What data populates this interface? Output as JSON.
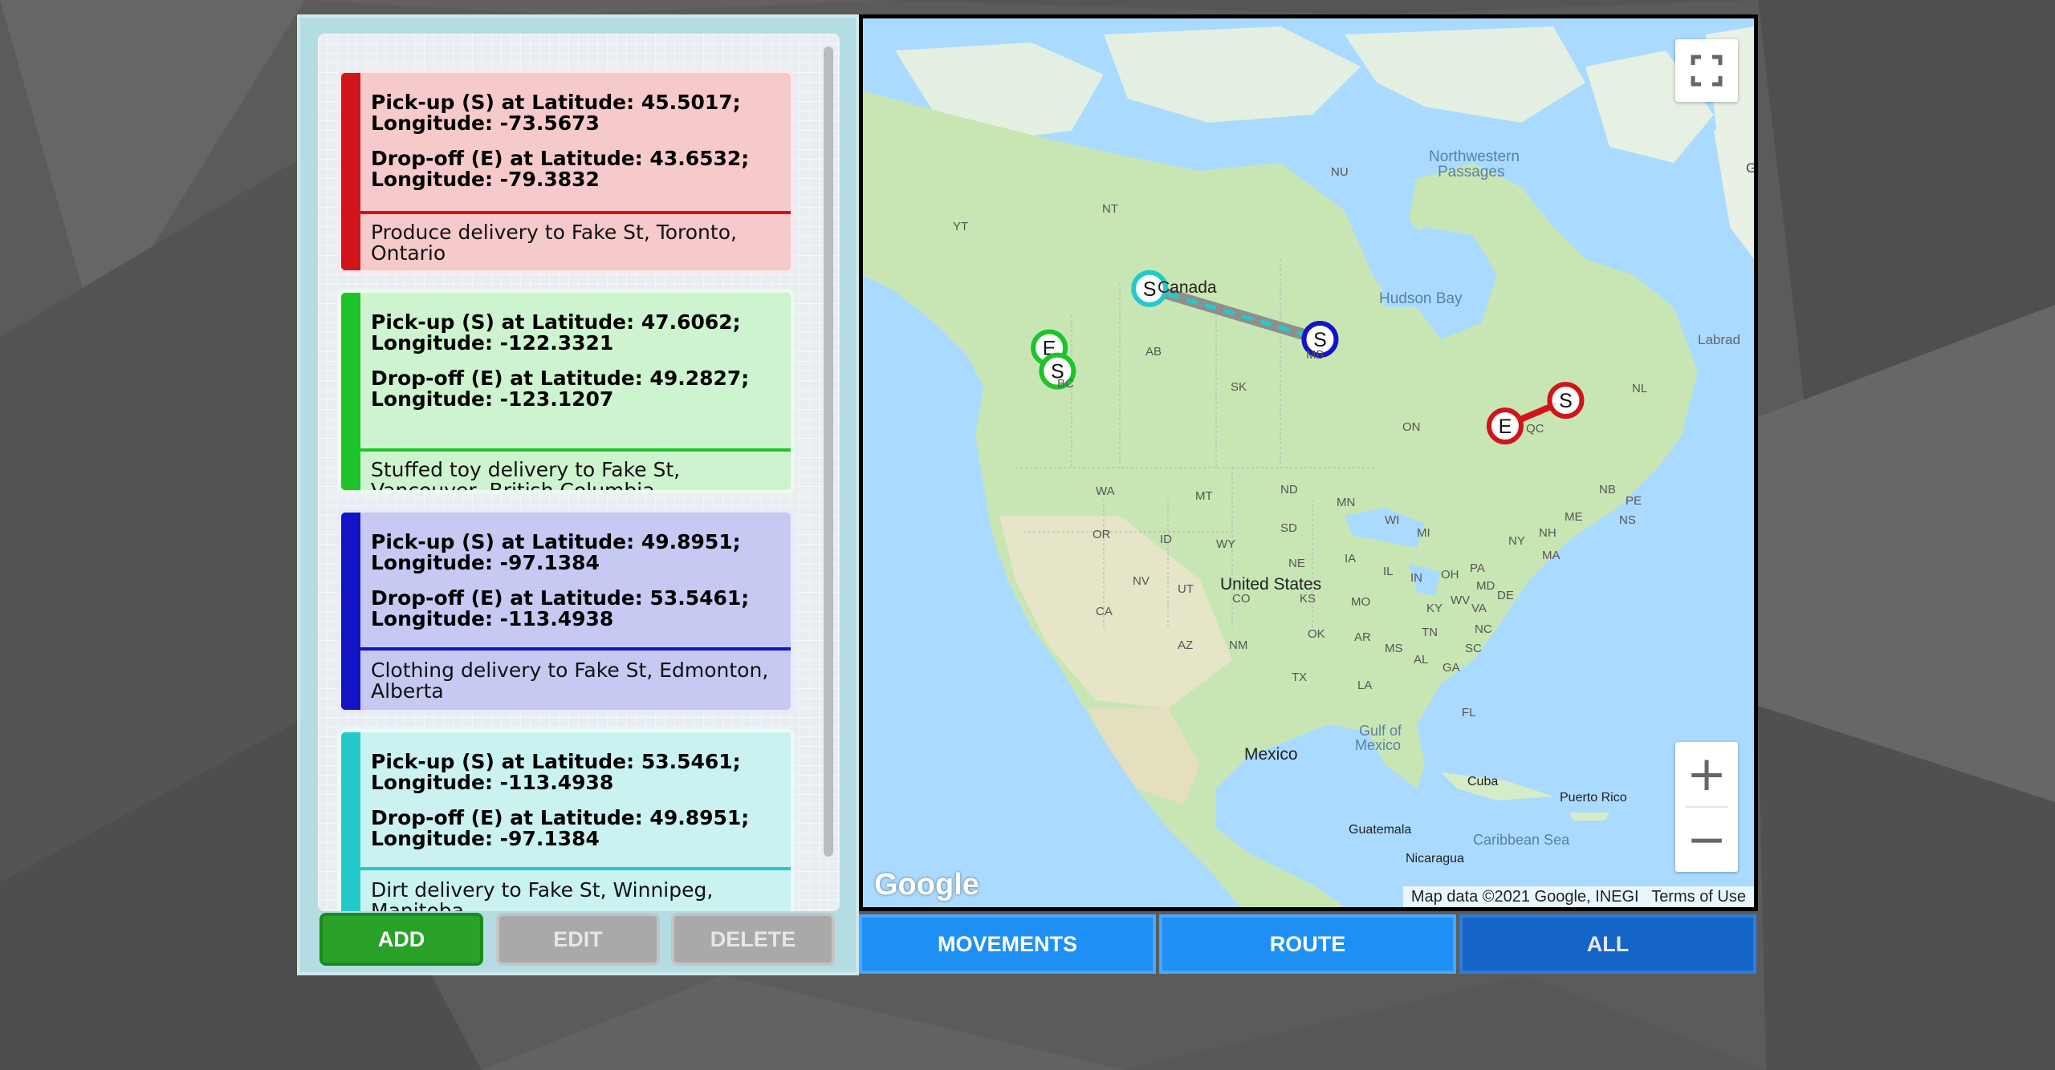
{
  "colors": {
    "red": "#d0141a",
    "green": "#1fc42a",
    "blue": "#1214c6",
    "teal": "#25c9cc",
    "card_red_bg": "#f6c9cb",
    "card_green_bg": "#cdf4cf",
    "card_blue_bg": "#c6caf3",
    "card_teal_bg": "#c9f2f0",
    "add_green": "#2aa22a",
    "disabled_gray": "#a9a9a9",
    "tab_blue": "#1e8ff5",
    "tab_blue_active": "#1565c8"
  },
  "movements": [
    {
      "color": "red",
      "pickup_text": "Pick-up (S) at Latitude: 45.5017;\nLongitude: -73.5673",
      "dropoff_text": "Drop-off (E) at Latitude: 43.6532;\nLongitude: -79.3832",
      "description": "Produce delivery to Fake St, Toronto,\nOntario",
      "pickup": {
        "lat": 45.5017,
        "lng": -73.5673
      },
      "dropoff": {
        "lat": 43.6532,
        "lng": -79.3832
      }
    },
    {
      "color": "green",
      "pickup_text": "Pick-up (S) at Latitude: 47.6062;\nLongitude: -122.3321",
      "dropoff_text": "Drop-off (E) at Latitude: 49.2827;\nLongitude: -123.1207",
      "description": "Stuffed toy delivery to Fake St,\nVancouver, British Columbia",
      "pickup": {
        "lat": 47.6062,
        "lng": -122.3321
      },
      "dropoff": {
        "lat": 49.2827,
        "lng": -123.1207
      }
    },
    {
      "color": "blue",
      "pickup_text": "Pick-up (S) at Latitude: 49.8951;\nLongitude: -97.1384",
      "dropoff_text": "Drop-off (E) at Latitude: 53.5461;\nLongitude: -113.4938",
      "description": "Clothing delivery to Fake St, Edmonton,\nAlberta",
      "pickup": {
        "lat": 49.8951,
        "lng": -97.1384
      },
      "dropoff": {
        "lat": 53.5461,
        "lng": -113.4938
      }
    },
    {
      "color": "teal",
      "pickup_text": "Pick-up (S) at Latitude: 53.5461;\nLongitude: -113.4938",
      "dropoff_text": "Drop-off (E) at Latitude: 49.8951;\nLongitude: -97.1384",
      "description": "Dirt delivery to Fake St, Winnipeg,\nManitoba",
      "pickup": {
        "lat": 53.5461,
        "lng": -113.4938
      },
      "dropoff": {
        "lat": 49.8951,
        "lng": -97.1384
      }
    }
  ],
  "buttons": {
    "add": "ADD",
    "edit": "EDIT",
    "delete": "DELETE"
  },
  "tabs": {
    "movements": "MOVEMENTS",
    "route": "ROUTE",
    "all": "ALL"
  },
  "map": {
    "attribution": "Map data ©2021 Google, INEGI",
    "terms": "Terms of Use",
    "logo": "Google",
    "zoom_in": "+",
    "zoom_out": "−",
    "icons": {
      "fullscreen": "fullscreen-icon",
      "zoom_in": "plus-icon",
      "zoom_out": "minus-icon"
    },
    "marker_start": "S",
    "marker_end": "E",
    "labels": {
      "canada": "Canada",
      "us": "United States",
      "mexico": "Mexico",
      "hudson": "Hudson Bay",
      "nw_passages_1": "Northwestern",
      "nw_passages_2": "Passages",
      "gulf_1": "Gulf of",
      "gulf_2": "Mexico",
      "caribbean": "Caribbean Sea",
      "cuba": "Cuba",
      "puerto_rico": "Puerto Rico",
      "guatemala": "Guatemala",
      "nicaragua": "Nicaragua",
      "labrador": "Labrad",
      "g": "G",
      "yt": "YT",
      "nt": "NT",
      "nu": "NU",
      "bc": "BC",
      "ab": "AB",
      "sk": "SK",
      "mb": "MB",
      "on": "ON",
      "qc": "QC",
      "nl": "NL",
      "nb": "NB",
      "pe": "PE",
      "ns": "NS",
      "wa": "WA",
      "or": "OR",
      "ca": "CA",
      "nv": "NV",
      "id": "ID",
      "mt": "MT",
      "wy": "WY",
      "ut": "UT",
      "az": "AZ",
      "co": "CO",
      "nm": "NM",
      "nd": "ND",
      "sd": "SD",
      "ne": "NE",
      "ks": "KS",
      "ok": "OK",
      "tx": "TX",
      "mn": "MN",
      "ia": "IA",
      "mo": "MO",
      "ar": "AR",
      "la": "LA",
      "wi": "WI",
      "il": "IL",
      "mi": "MI",
      "in": "IN",
      "oh": "OH",
      "ky": "KY",
      "tn": "TN",
      "ms": "MS",
      "al": "AL",
      "ga": "GA",
      "fl": "FL",
      "sc": "SC",
      "nc": "NC",
      "va": "VA",
      "wv": "WV",
      "pa": "PA",
      "ny": "NY",
      "md": "MD",
      "de": "DE",
      "ma": "MA",
      "nh": "NH",
      "me": "ME"
    }
  }
}
